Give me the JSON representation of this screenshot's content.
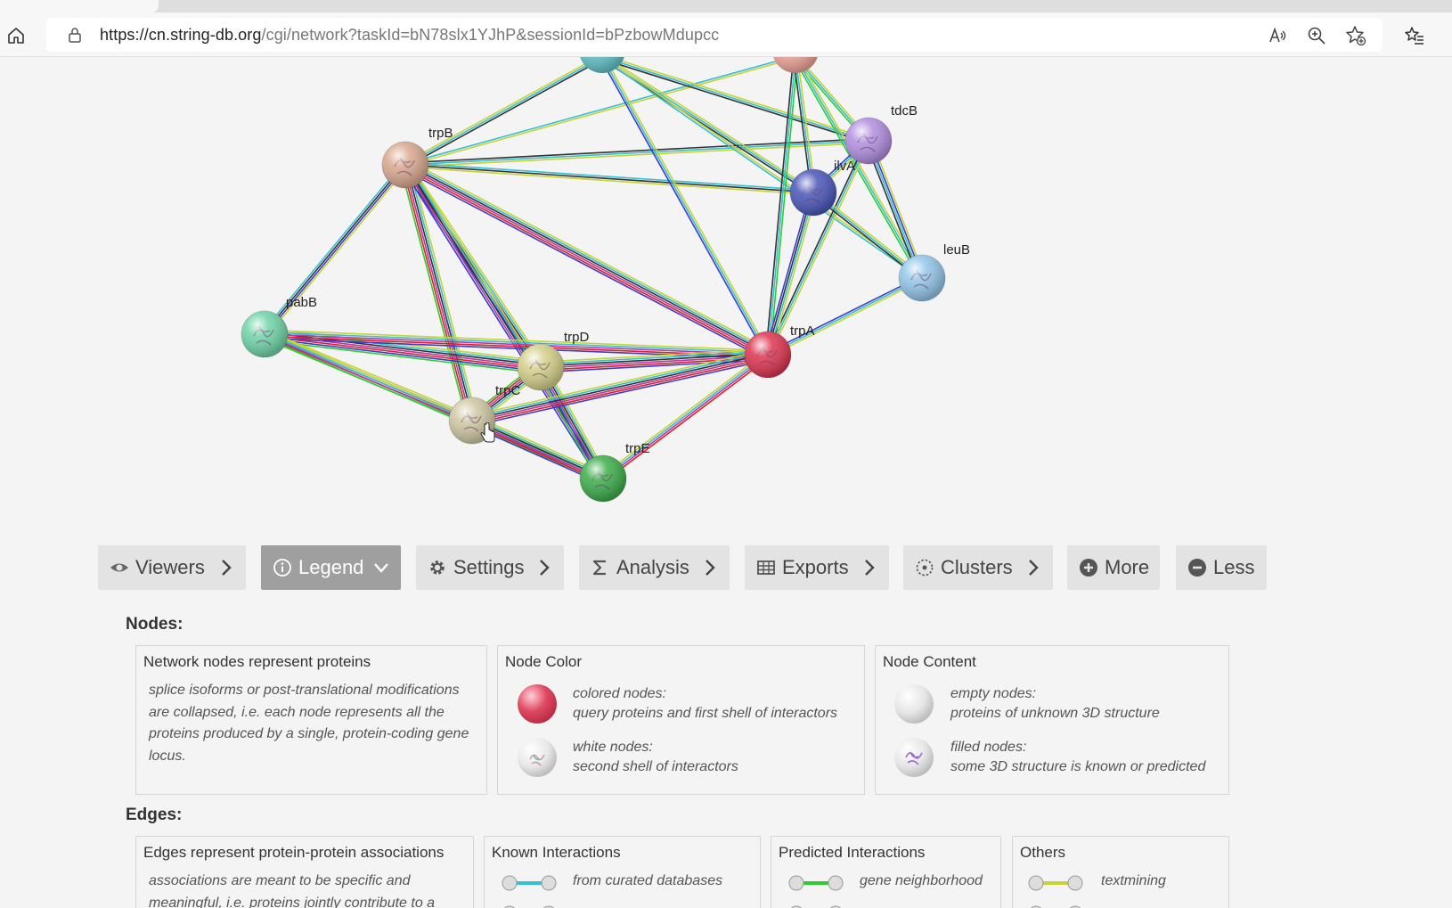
{
  "browser": {
    "url_host": "https://cn.string-db.org",
    "url_path": "/cgi/network?taskId=bN78slx1YJhP&sessionId=bPzbowMdupcc"
  },
  "network": {
    "nodes": [
      {
        "id": "trpB",
        "label": "trpB",
        "color": "#d9a88f"
      },
      {
        "id": "tdcB",
        "label": "tdcB",
        "color": "#b28ee0"
      },
      {
        "id": "ilvA",
        "label": "ilvA",
        "color": "#4a56b8"
      },
      {
        "id": "leuB",
        "label": "leuB",
        "color": "#93c6ea"
      },
      {
        "id": "pabB",
        "label": "pabB",
        "color": "#6fd4a8"
      },
      {
        "id": "trpD",
        "label": "trpD",
        "color": "#d4d08a"
      },
      {
        "id": "trpA",
        "label": "trpA",
        "color": "#dd3550"
      },
      {
        "id": "trpC",
        "label": "trpC",
        "color": "#cfc7a3"
      },
      {
        "id": "trpE",
        "label": "trpE",
        "color": "#3cad4a"
      }
    ]
  },
  "menu": {
    "viewers": "Viewers",
    "legend": "Legend",
    "settings": "Settings",
    "analysis": "Analysis",
    "exports": "Exports",
    "clusters": "Clusters",
    "more": "More",
    "less": "Less"
  },
  "legend": {
    "nodes_title": "Nodes:",
    "box1": {
      "title": "Network nodes represent proteins",
      "text": "splice isoforms or post-translational modifications are collapsed, i.e. each node represents all the proteins produced by a single, protein-coding gene locus."
    },
    "node_color": {
      "title": "Node Color",
      "colored_label": "colored nodes:",
      "colored_desc": "query proteins and first shell of interactors",
      "white_label": "white nodes:",
      "white_desc": "second shell of interactors"
    },
    "node_content": {
      "title": "Node Content",
      "empty_label": "empty nodes:",
      "empty_desc": "proteins of unknown 3D structure",
      "filled_label": "filled nodes:",
      "filled_desc": "some 3D structure is known or predicted"
    },
    "edges_title": "Edges:",
    "edges_box": {
      "title": "Edges represent protein-protein associations",
      "text": "associations are meant to be specific and meaningful, i.e. proteins jointly contribute to a"
    },
    "known": {
      "title": "Known Interactions",
      "item1": "from curated databases"
    },
    "predicted": {
      "title": "Predicted Interactions",
      "item1": "gene neighborhood"
    },
    "others": {
      "title": "Others",
      "item1": "textmining"
    },
    "colors": {
      "curated": "#35bfd4",
      "neighborhood": "#2ecc2e",
      "textmining": "#c8d232"
    }
  }
}
